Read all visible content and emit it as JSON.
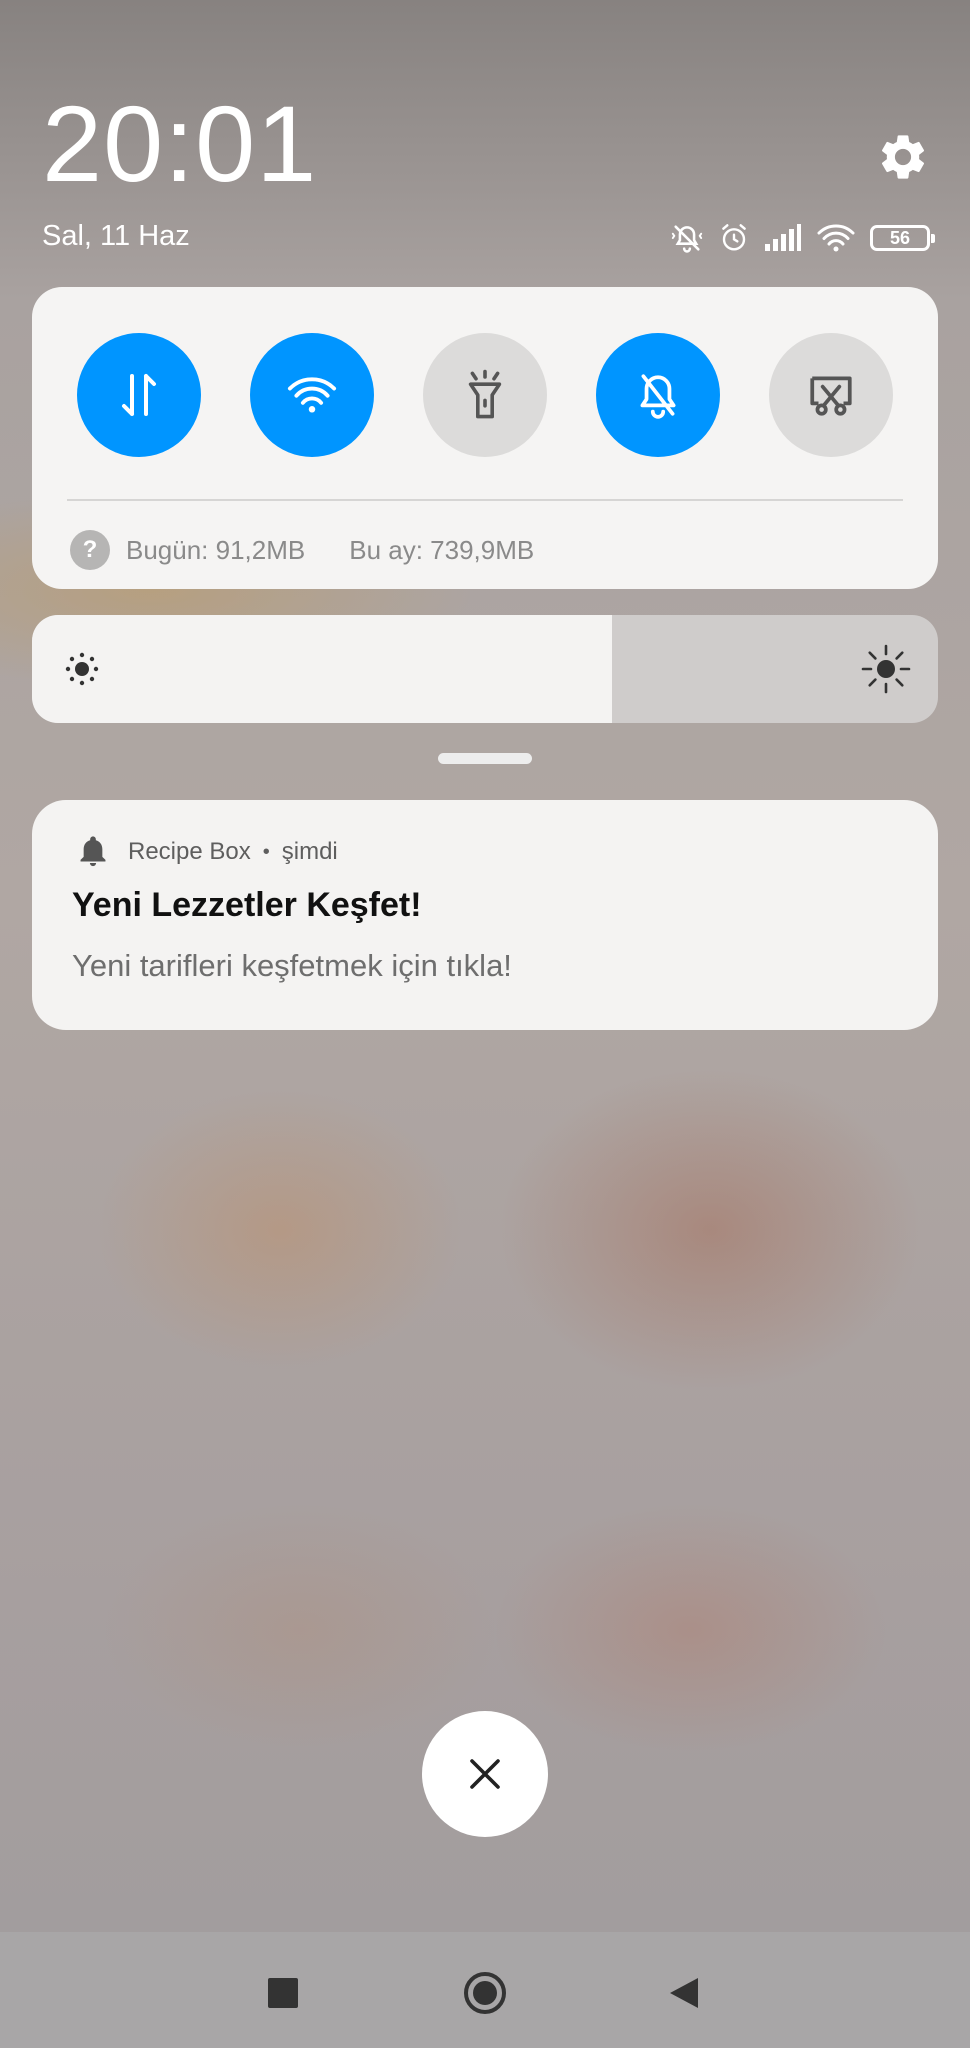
{
  "header": {
    "time": "20:01",
    "date": "Sal, 11 Haz",
    "settings_icon": "gear-icon"
  },
  "status_bar": {
    "icons": [
      "vibrate-off-icon",
      "alarm-icon",
      "signal-icon",
      "wifi-icon"
    ],
    "battery_level": "56"
  },
  "quick_settings": {
    "toggles": [
      {
        "name": "mobile-data",
        "icon": "data-arrows-icon",
        "state": "on"
      },
      {
        "name": "wifi",
        "icon": "wifi-icon",
        "state": "on"
      },
      {
        "name": "flashlight",
        "icon": "flashlight-icon",
        "state": "off"
      },
      {
        "name": "silent",
        "icon": "bell-off-icon",
        "state": "on"
      },
      {
        "name": "screenshot",
        "icon": "screenshot-icon",
        "state": "off"
      }
    ],
    "usage_today": "Bugün: 91,2MB",
    "usage_month": "Bu ay: 739,9MB",
    "help_glyph": "?"
  },
  "brightness": {
    "level_percent": 64
  },
  "notification": {
    "app_name": "Recipe Box",
    "separator": "•",
    "time": "şimdi",
    "title": "Yeni Lezzetler Keşfet!",
    "body": "Yeni tarifleri keşfetmek için tıkla!"
  },
  "colors": {
    "accent": "#0095ff",
    "toggle_off": "#dcdbda",
    "card": "#f4f3f2"
  }
}
